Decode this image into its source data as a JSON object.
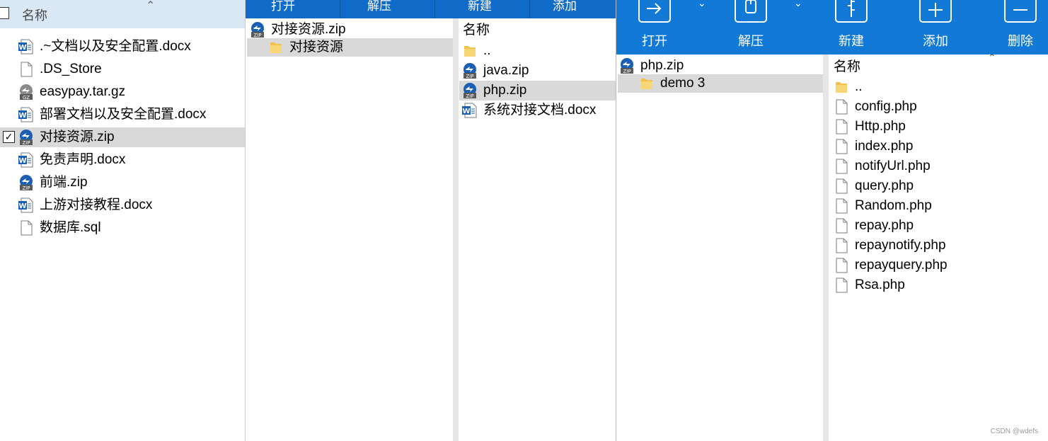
{
  "panel1": {
    "header": "名称",
    "files": [
      {
        "name": ".~文档以及安全配置.docx",
        "icon": "word-icon"
      },
      {
        "name": ".DS_Store",
        "icon": "file-icon"
      },
      {
        "name": "easypay.tar.gz",
        "icon": "gz-archive-icon"
      },
      {
        "name": "部署文档以及安全配置.docx",
        "icon": "word-icon"
      },
      {
        "name": "对接资源.zip",
        "icon": "zip-icon",
        "selected": true,
        "checked": true
      },
      {
        "name": "免责声明.docx",
        "icon": "word-icon"
      },
      {
        "name": "前端.zip",
        "icon": "zip-icon"
      },
      {
        "name": "上游对接教程.docx",
        "icon": "word-icon"
      },
      {
        "name": "数据库.sql",
        "icon": "file-icon"
      }
    ]
  },
  "panel2": {
    "toolbar": [
      "打开",
      "解压",
      "新建",
      "添加"
    ],
    "tree": {
      "root": "对接资源.zip",
      "child": "对接资源"
    },
    "list_header": "名称",
    "files": [
      {
        "name": "..",
        "icon": "folder-icon"
      },
      {
        "name": "java.zip",
        "icon": "zip-icon"
      },
      {
        "name": "php.zip",
        "icon": "zip-icon",
        "selected": true
      },
      {
        "name": "系统对接文档.docx",
        "icon": "word-icon"
      }
    ]
  },
  "panel3": {
    "toolbar": [
      "打开",
      "解压",
      "新建",
      "添加",
      "删除"
    ],
    "tree": {
      "root": "php.zip",
      "child": "demo 3"
    },
    "list_header": "名称",
    "files": [
      {
        "name": "..",
        "icon": "folder-icon"
      },
      {
        "name": "config.php",
        "icon": "file-icon"
      },
      {
        "name": "Http.php",
        "icon": "file-icon"
      },
      {
        "name": "index.php",
        "icon": "file-icon"
      },
      {
        "name": "notifyUrl.php",
        "icon": "file-icon"
      },
      {
        "name": "query.php",
        "icon": "file-icon"
      },
      {
        "name": "Random.php",
        "icon": "file-icon"
      },
      {
        "name": "repay.php",
        "icon": "file-icon"
      },
      {
        "name": "repaynotify.php",
        "icon": "file-icon"
      },
      {
        "name": "repayquery.php",
        "icon": "file-icon"
      },
      {
        "name": "Rsa.php",
        "icon": "file-icon"
      }
    ]
  },
  "watermark": "CSDN @wdefs",
  "colors": {
    "toolbar_blue": "#1379d6",
    "selection_gray": "#d9d9d9",
    "header_blue": "#dae8f5"
  }
}
